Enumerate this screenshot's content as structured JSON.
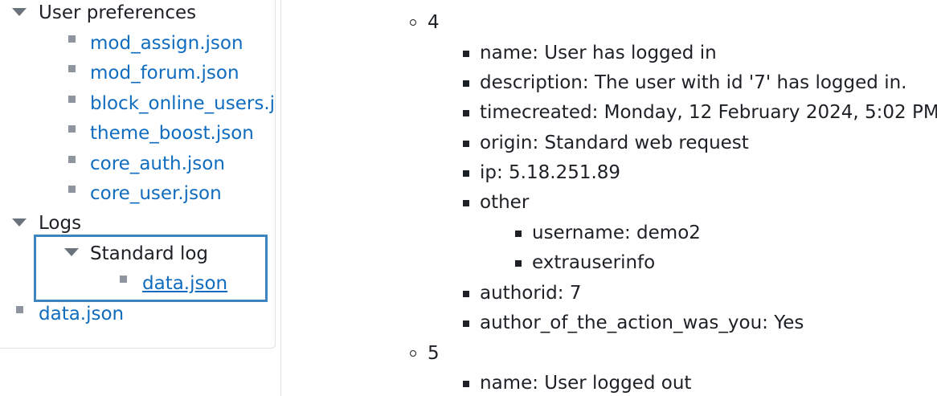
{
  "sidebar": {
    "user_preferences": {
      "label": "User preferences",
      "files": [
        "mod_assign.json",
        "mod_forum.json",
        "block_online_users.json",
        "theme_boost.json",
        "core_auth.json",
        "core_user.json"
      ]
    },
    "logs": {
      "label": "Logs",
      "standard_log": {
        "label": "Standard log",
        "file": "data.json"
      }
    },
    "root_file": "data.json"
  },
  "main": {
    "entry4": {
      "index": "4",
      "fields": {
        "name": "name: User has logged in",
        "description": "description: The user with id '7' has logged in.",
        "timecreated": "timecreated: Monday, 12 February 2024, 5:02 PM",
        "origin": "origin: Standard web request",
        "ip": "ip: 5.18.251.89",
        "other": "other",
        "username": "username: demo2",
        "extrauserinfo": "extrauserinfo",
        "authorid": "authorid: 7",
        "author_of_the_action_was_you": "author_of_the_action_was_you: Yes"
      }
    },
    "entry5": {
      "index": "5",
      "fields": {
        "name": "name: User logged out"
      }
    }
  }
}
